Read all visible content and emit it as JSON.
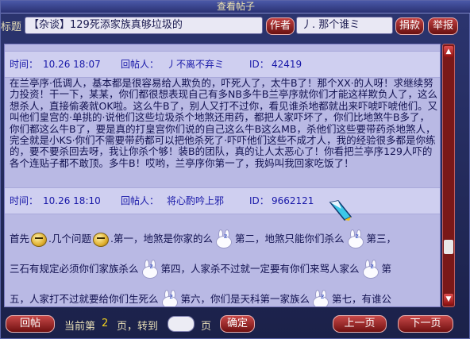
{
  "window": {
    "title": "查看帖子"
  },
  "header": {
    "subject_label": "标题",
    "subject": "【杂谈】129死添家族真够垃圾的",
    "author_button": "作者",
    "author": "丿. 那个谁ミ",
    "donate_button": "捐款",
    "report_button": "举报"
  },
  "posts": [
    {
      "time_label": "时间：",
      "time": "10.26 18:07",
      "poster_label": "回帖人：",
      "poster": "丿不离不弃ミ",
      "id_label": "ID：",
      "id": "42419",
      "body": "在兰亭序·低调人，基本都是很容易给人欺负的，吓死人了，太牛B了！那个XX·的人呀！求继续努力投资！干一下，某某，你们都很想表现自己有多NB多牛B兰亭序就你们才能这样欺负人了，这么想杀人，直接偷袭就OK啦。这么牛B了，别人又打不过你，看见谁杀地都就出来吓唬吓唬他们。又叫他们皇宫的·单挑的·说他们这些垃圾杀个地煞还用药，都把人家吓坏了，你们比地煞牛B多了，你们都这么牛B了，要是真的打皇宫你们说的自己这么牛B这么MB，杀他们这些要带药杀地煞人，完全就是小KS·你们不需要带药都可以把他杀死了·吓吓他们这些不成才人，我的经验很多都是你练的，要不要杀回去呀，我让你杀个够！装B的团队，真的让人太恶心了！你看把兰亭序129人吓的各个连贴子都不敢顶。多牛B！哎哟，兰亭序你第一了，我妈叫我回家吃饭了！"
    },
    {
      "time_label": "时间：",
      "time": "10.26 18:10",
      "poster_label": "回帖人：",
      "poster": "将心酌吟上邪",
      "id_label": "ID：",
      "id": "9662121",
      "lines": [
        [
          "首先",
          ".几个问题",
          ".第一，地煞是你家的么",
          "第二，地煞只能你们杀么",
          "第三，"
        ],
        [
          "三石有规定必须你们家族杀么",
          "第四，人家杀不过就一定要有你们来骂人家么",
          "第"
        ],
        [
          "五，人家打不过就要给你们生死么",
          "第六，你们是天科第一家族么",
          "第七，有谁公"
        ]
      ]
    }
  ],
  "footer": {
    "reply_button": "回帖",
    "current_prefix": "当前第",
    "current_page": "2",
    "page_goto": "页，转到",
    "page_suffix": "页",
    "confirm_button": "确定",
    "prev_button": "上一页",
    "next_button": "下一页"
  },
  "scrollbar": {
    "up_icon": "▲",
    "down_icon": "▼"
  }
}
